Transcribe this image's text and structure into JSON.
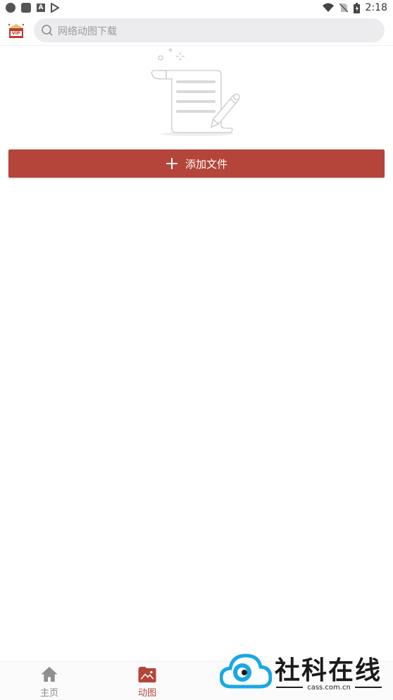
{
  "status_bar": {
    "time": "2:18",
    "left_icons": [
      "notification-dot-icon",
      "app-square-icon",
      "font-a-icon",
      "play-store-icon"
    ],
    "right_icons": [
      "wifi-icon",
      "no-sim-icon",
      "battery-icon"
    ],
    "small_a": "A"
  },
  "header": {
    "logo_text": "VIP",
    "search_placeholder": "网络动图下载"
  },
  "main": {
    "add_file_label": "添加文件"
  },
  "bottom_nav": {
    "items": [
      {
        "label": "主页",
        "icon": "home-icon",
        "active": false
      },
      {
        "label": "动图",
        "icon": "gif-gallery-icon",
        "active": true
      }
    ]
  },
  "watermark": {
    "title": "社科在线",
    "url": "cass.com.cn"
  },
  "colors": {
    "accent": "#b5453a",
    "search_bg": "#ececef",
    "inactive_nav": "#8a8a8a"
  }
}
